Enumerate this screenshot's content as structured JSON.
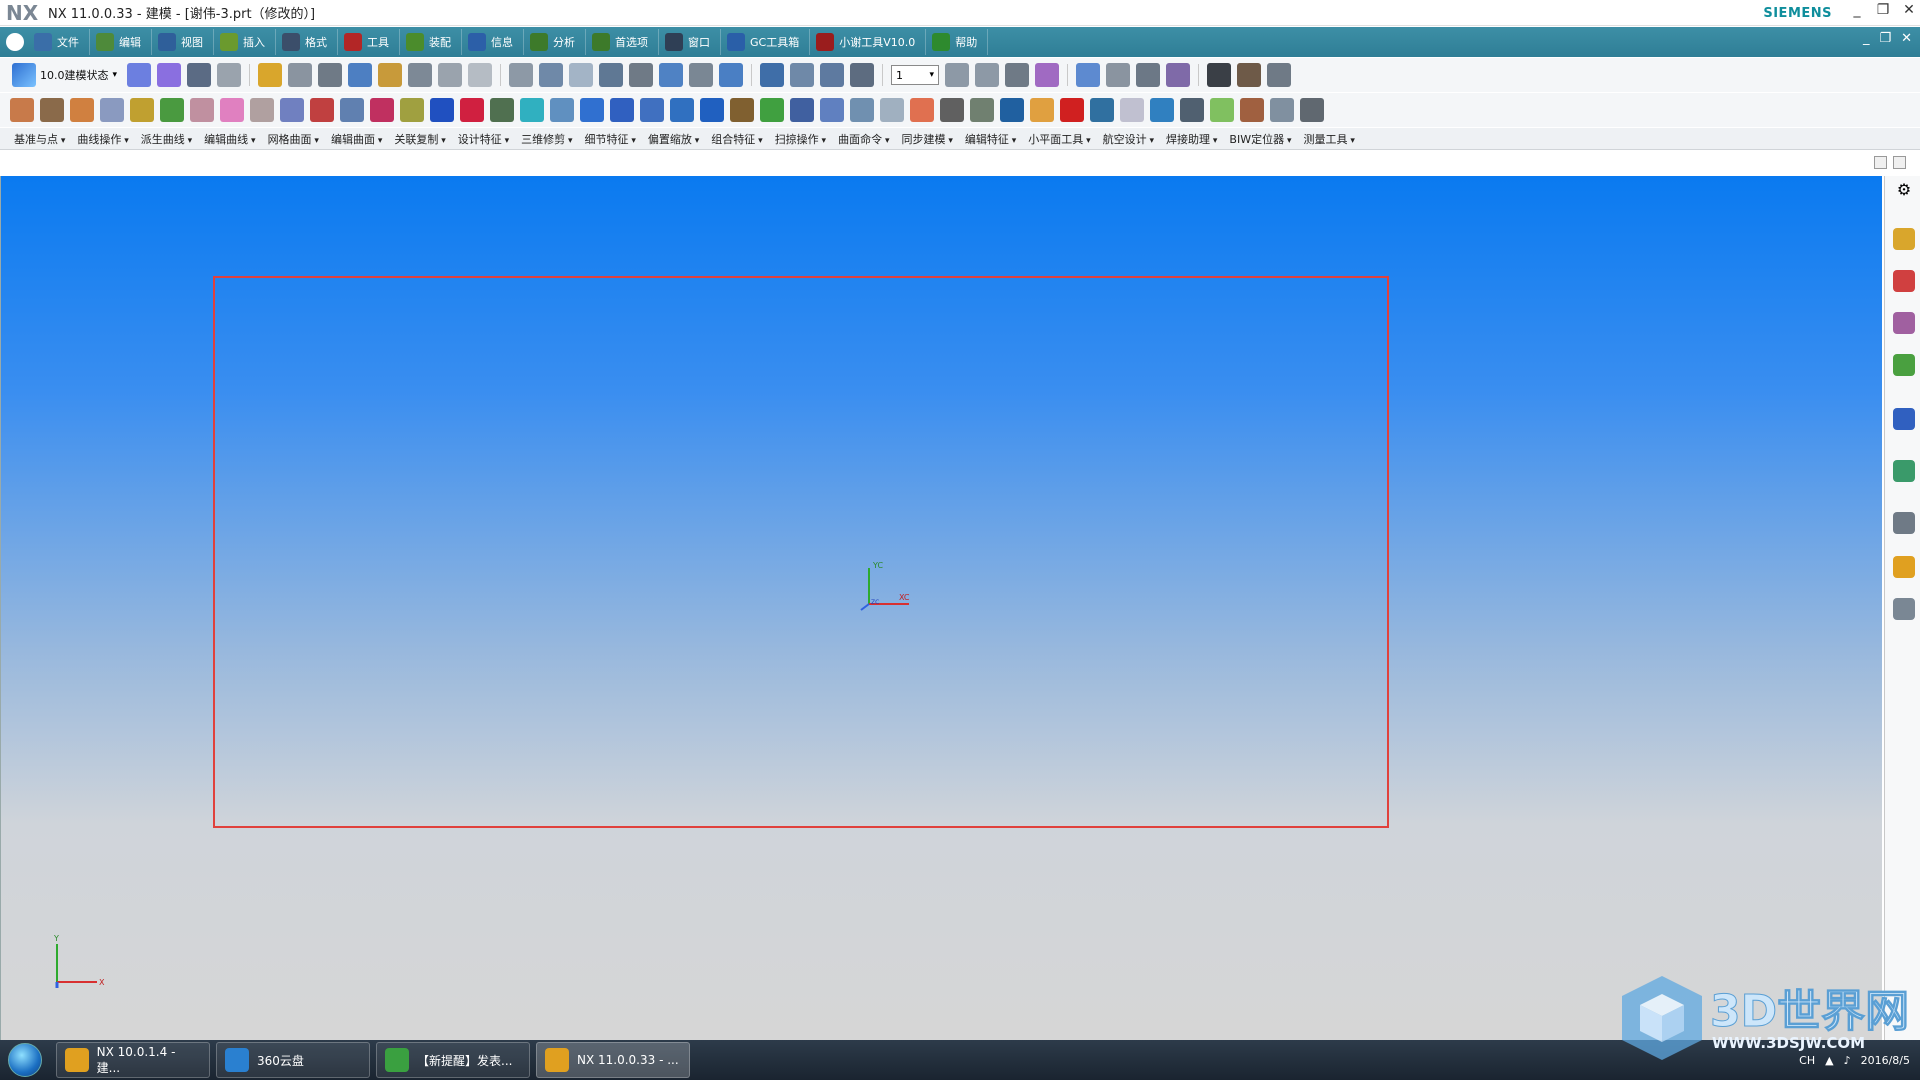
{
  "app": {
    "logo": "NX",
    "title": "NX 11.0.0.33 - 建模 - [谢伟-3.prt（修改的）]",
    "brand": "SIEMENS"
  },
  "menubar": {
    "items": [
      {
        "label": "文件",
        "icon": "clock-icon",
        "color": "#3a6ea8"
      },
      {
        "label": "编辑",
        "icon": "edit-icon",
        "color": "#4e8a3a"
      },
      {
        "label": "视图",
        "icon": "view-icon",
        "color": "#2f5f9a"
      },
      {
        "label": "插入",
        "icon": "insert-icon",
        "color": "#6b9a2e"
      },
      {
        "label": "格式",
        "icon": "format-icon",
        "color": "#3b4e6a"
      },
      {
        "label": "工具",
        "icon": "flag-icon",
        "color": "#b32626"
      },
      {
        "label": "装配",
        "icon": "assembly-icon",
        "color": "#4b8c2c"
      },
      {
        "label": "信息",
        "icon": "plus-icon",
        "color": "#2c5fa8"
      },
      {
        "label": "分析",
        "icon": "question-icon",
        "color": "#3d7a2a"
      },
      {
        "label": "首选项",
        "icon": "exclaim-icon",
        "color": "#3d7a2a"
      },
      {
        "label": "窗口",
        "icon": "anchor-icon",
        "color": "#2f3f55"
      },
      {
        "label": "GC工具箱",
        "icon": "cube-icon",
        "color": "#2a5fa8"
      },
      {
        "label": "小谢工具V10.0",
        "icon": "exclaim-icon",
        "color": "#9a1d1d"
      },
      {
        "label": "帮助",
        "icon": "check-icon",
        "color": "#2e8a2e"
      }
    ]
  },
  "toolbar1": {
    "state_label": "10.0建模状态",
    "layer_value": "1"
  },
  "groupbar": {
    "items": [
      "基准与点",
      "曲线操作",
      "派生曲线",
      "编辑曲线",
      "网格曲面",
      "编辑曲面",
      "关联复制",
      "设计特征",
      "三维修剪",
      "细节特征",
      "偏置缩放",
      "组合特征",
      "扫掠操作",
      "曲面命令",
      "同步建模",
      "编辑特征",
      "小平面工具",
      "航空设计",
      "焊接助理",
      "BIW定位器",
      "测量工具"
    ]
  },
  "viewport": {
    "csys_center": {
      "y_label": "YC",
      "x_label": "XC",
      "z_label": "ZC"
    },
    "csys_corner": {
      "y_label": "Y",
      "x_label": "X"
    }
  },
  "taskbar": {
    "tasks": [
      {
        "label": "NX 10.0.1.4 - 建...",
        "icon": "nx-icon"
      },
      {
        "label": "360云盘",
        "icon": "cloud-icon"
      },
      {
        "label": "【新提醒】发表...",
        "icon": "browser-icon"
      },
      {
        "label": "NX 11.0.0.33 - ...",
        "icon": "nx-icon"
      }
    ],
    "lang": "CH",
    "date": "2016/8/5"
  },
  "watermark": {
    "text": "3D世界网",
    "url": "WWW.3DSJW.COM"
  }
}
